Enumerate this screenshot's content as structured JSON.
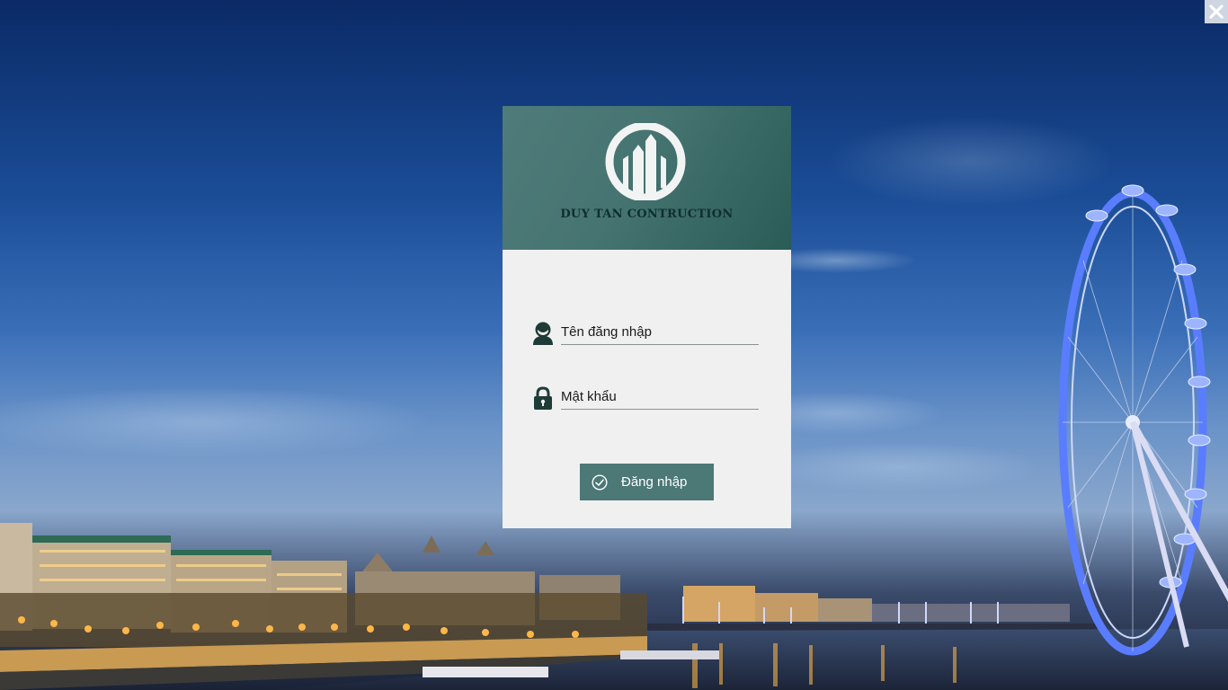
{
  "window": {
    "close_icon": "close-icon"
  },
  "brand": {
    "company_name": "DUY TAN CONTRUCTION",
    "logo_icon": "building-logo-icon",
    "header_color": "#4f7c7a"
  },
  "login_form": {
    "username": {
      "placeholder": "Tên đăng nhập",
      "value": "",
      "icon": "user-icon"
    },
    "password": {
      "placeholder": "Mật khẩu",
      "value": "",
      "icon": "lock-icon"
    },
    "submit": {
      "label": "Đăng nhập",
      "icon": "check-circle-icon",
      "color": "#4c7876"
    }
  }
}
